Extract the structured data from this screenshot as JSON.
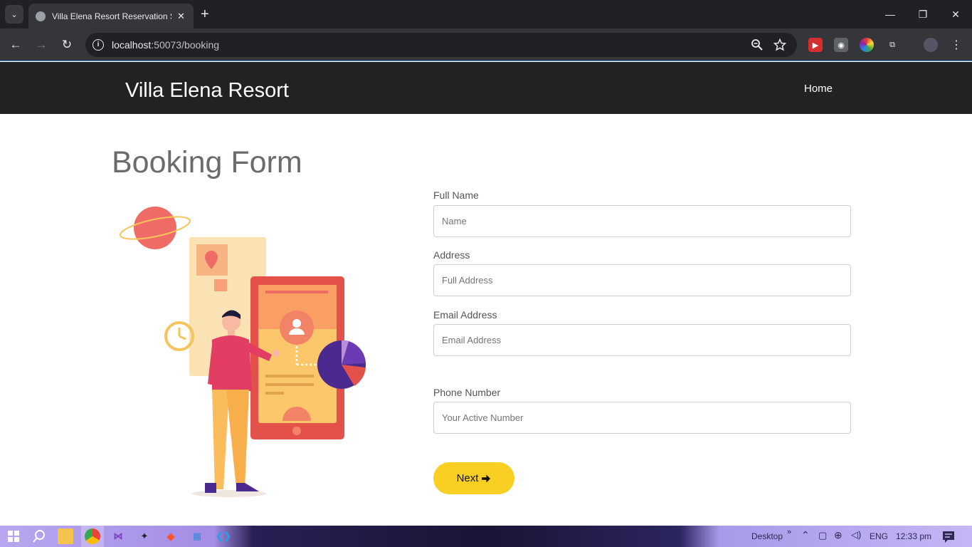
{
  "browser": {
    "tab_title": "Villa Elena Resort Reservation Sy",
    "tab_close": "✕",
    "new_tab": "+",
    "url_host": "localhost",
    "url_path": ":50073/booking",
    "window_controls": [
      "—",
      "❐",
      "✕"
    ]
  },
  "site": {
    "brand": "Villa Elena Resort",
    "nav": [
      {
        "label": "Home"
      }
    ]
  },
  "form": {
    "title": "Booking Form",
    "fields": [
      {
        "label": "Full Name",
        "placeholder": "Name",
        "value": ""
      },
      {
        "label": "Address",
        "placeholder": "Full Address",
        "value": ""
      },
      {
        "label": "Email Address",
        "placeholder": "Email Address",
        "value": ""
      },
      {
        "label": "Phone Number",
        "placeholder": "Your Active Number",
        "value": ""
      }
    ],
    "submit_label": "Next",
    "submit_icon": "arrow-right-icon",
    "accent_color": "#f9cf23"
  },
  "taskbar": {
    "desktop_label": "Desktop",
    "language": "ENG",
    "time": "12:33 pm"
  },
  "colors": {
    "header_bg": "#222222",
    "tab_bg": "#35363a",
    "title_text": "#6b6b6b"
  }
}
